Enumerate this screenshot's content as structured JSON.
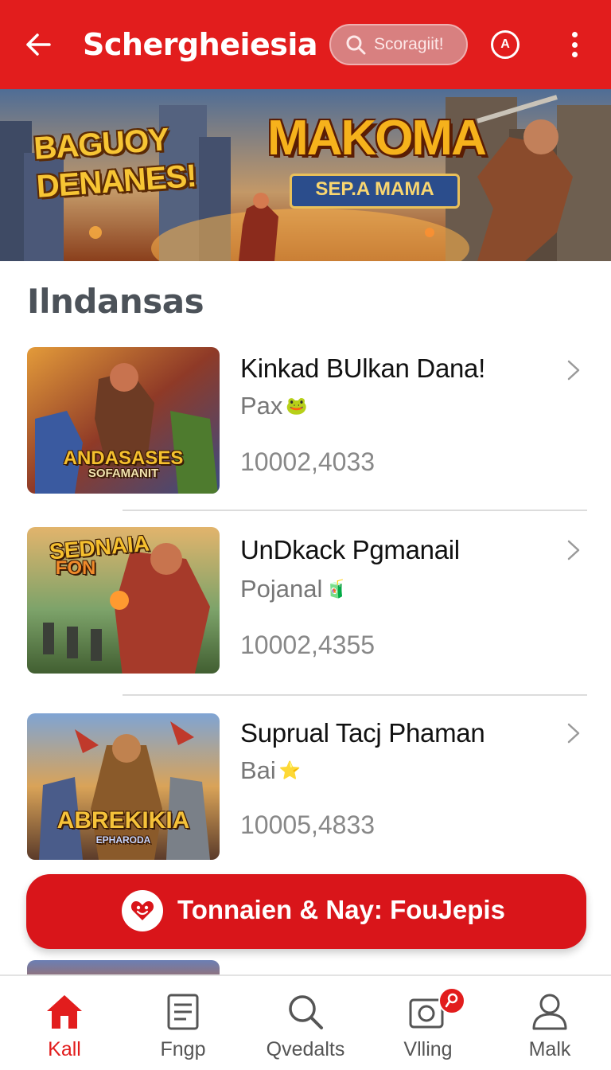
{
  "header": {
    "title": "Schergheiesia",
    "search_placeholder": "Scoragiit!",
    "account_letter": "A"
  },
  "banner": {
    "left_text_line1": "BAGUOY",
    "left_text_line2": "DENANES!",
    "logo_title": "MAKOMA",
    "logo_subtitle": "SEP.A MAMA"
  },
  "section": {
    "title": "Ilndansas"
  },
  "items": [
    {
      "name": "Kinkad BUlkan Dana!",
      "subtitle": "Pax",
      "emoji": "🐸",
      "count": "10002,4033",
      "thumb_caption_1": "ANDASASES",
      "thumb_caption_2": "SOFAMANIT"
    },
    {
      "name": "UnDkack Pgmanail",
      "subtitle": "Pojanal",
      "emoji": "🧃",
      "count": "10002,4355",
      "thumb_caption_1": "SEDNAIA",
      "thumb_caption_2": "FON"
    },
    {
      "name": "Suprual Tacj Phaman",
      "subtitle": "Bai",
      "emoji": "⭐",
      "count": "10005,4833",
      "thumb_caption_1": "ABREKIKIA",
      "thumb_caption_2": "EPHARODA"
    }
  ],
  "cta": {
    "label": "Tonnaien & Nay: FouJepis"
  },
  "bottom_nav": [
    {
      "label": "Kall",
      "icon": "home-icon",
      "active": true
    },
    {
      "label": "Fngp",
      "icon": "document-icon",
      "active": false
    },
    {
      "label": "Qvedalts",
      "icon": "search-icon",
      "active": false
    },
    {
      "label": "Vlling",
      "icon": "camera-icon",
      "active": false
    },
    {
      "label": "Malk",
      "icon": "profile-icon",
      "active": false
    }
  ],
  "colors": {
    "brand_red": "#e21d1d",
    "cta_red": "#d9151a",
    "text_gray": "#777777",
    "heading_gray": "#4c5259"
  }
}
